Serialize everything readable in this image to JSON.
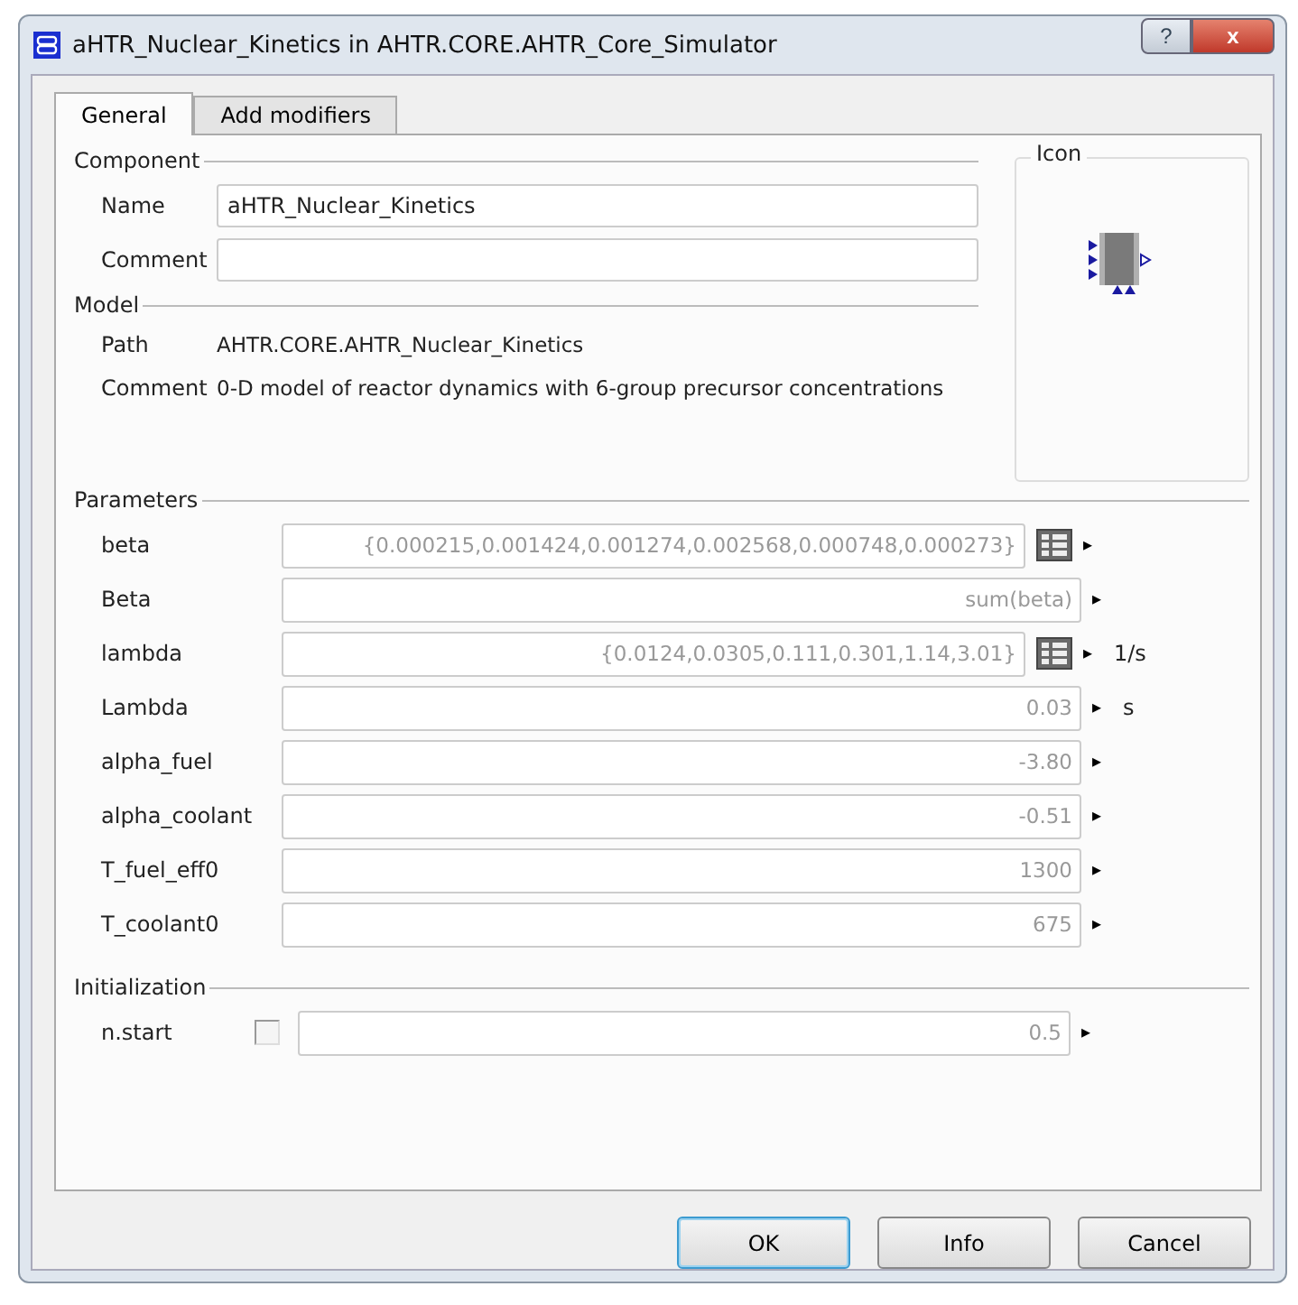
{
  "window": {
    "title": "aHTR_Nuclear_Kinetics in AHTR.CORE.AHTR_Core_Simulator",
    "help_button": "?",
    "close_button": "x"
  },
  "tabs": [
    {
      "label": "General",
      "selected": true
    },
    {
      "label": "Add modifiers",
      "selected": false
    }
  ],
  "component": {
    "heading": "Component",
    "name_label": "Name",
    "name_value": "aHTR_Nuclear_Kinetics",
    "comment_label": "Comment"
  },
  "icon_panel": {
    "heading": "Icon"
  },
  "model": {
    "heading": "Model",
    "path_label": "Path",
    "path_value": "AHTR.CORE.AHTR_Nuclear_Kinetics",
    "comment_label": "Comment",
    "comment_value": "0-D model of reactor dynamics with 6-group precursor concentrations"
  },
  "parameters": {
    "heading": "Parameters",
    "rows": [
      {
        "name": "beta",
        "kind": "array",
        "placeholder": "{0.000215,0.001424,0.001274,0.002568,0.000748,0.000273}",
        "arrow": "▸"
      },
      {
        "name": "Beta",
        "kind": "scalar",
        "placeholder": "sum(beta)",
        "arrow": "▸"
      },
      {
        "name": "lambda",
        "kind": "array",
        "placeholder": "{0.0124,0.0305,0.111,0.301,1.14,3.01}",
        "arrow": "▸",
        "unit": "1/s"
      },
      {
        "name": "Lambda",
        "kind": "scalar",
        "placeholder": "0.03",
        "arrow": "▸",
        "unit": "s"
      },
      {
        "name": "alpha_fuel",
        "kind": "scalar",
        "placeholder": "-3.80",
        "arrow": "▸"
      },
      {
        "name": "alpha_coolant",
        "kind": "scalar",
        "placeholder": "-0.51",
        "arrow": "▸"
      },
      {
        "name": "T_fuel_eff0",
        "kind": "scalar",
        "placeholder": "1300",
        "arrow": "▸"
      },
      {
        "name": "T_coolant0",
        "kind": "scalar",
        "placeholder": "675",
        "arrow": "▸"
      }
    ]
  },
  "initialization": {
    "heading": "Initialization",
    "rows": [
      {
        "name": "n.start",
        "checked": false,
        "placeholder": "0.5",
        "arrow": "▸"
      }
    ]
  },
  "buttons": [
    {
      "label": "OK",
      "default": true
    },
    {
      "label": "Info",
      "default": false
    },
    {
      "label": "Cancel",
      "default": false
    }
  ]
}
